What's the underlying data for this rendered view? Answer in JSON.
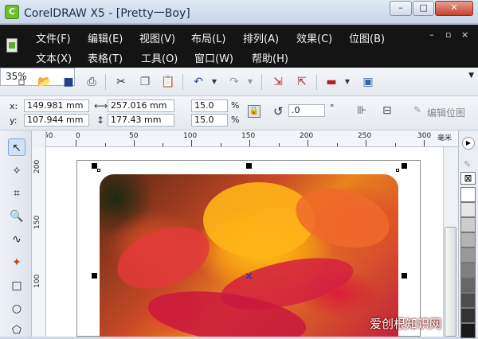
{
  "window": {
    "title": "CorelDRAW X5 - [Pretty一Boy]",
    "app_icon": "coreldraw-app-icon",
    "minimize": "–",
    "maximize": "□",
    "close": "✕"
  },
  "menubar": {
    "row1": [
      "文件(F)",
      "编辑(E)",
      "视图(V)",
      "布局(L)",
      "排列(A)",
      "效果(C)",
      "位图(B)"
    ],
    "row2": [
      "文本(X)",
      "表格(T)",
      "工具(O)",
      "窗口(W)",
      "帮助(H)"
    ],
    "mdi": [
      "–",
      "▫",
      "×"
    ]
  },
  "toolbar": {
    "icons": [
      "new-document-icon",
      "open-icon",
      "save-icon",
      "print-icon",
      "cut-icon",
      "copy-icon",
      "paste-icon",
      "undo-icon",
      "redo-icon",
      "import-icon",
      "export-icon",
      "application-launcher-icon",
      "welcome-screen-icon"
    ],
    "zoom": "35%"
  },
  "propbar": {
    "x_label": "x:",
    "x_value": "149.981 mm",
    "y_label": "y:",
    "y_value": "107.944 mm",
    "w_value": "257.016 mm",
    "h_value": "177.43 mm",
    "scale_w": "15.0",
    "scale_h": "15.0",
    "pct1": "%",
    "pct2": "%",
    "rotation": ".0",
    "degree": "°",
    "edit_bitmap": "编辑位图"
  },
  "ruler": {
    "h_labels": [
      "50",
      "0",
      "50",
      "100",
      "150",
      "200",
      "250",
      "300"
    ],
    "h_unit": "毫米",
    "v_labels": [
      "200",
      "150",
      "100"
    ]
  },
  "toolbox": [
    "pick-tool-icon",
    "shape-tool-icon",
    "crop-tool-icon",
    "zoom-tool-icon",
    "freehand-tool-icon",
    "smart-fill-tool-icon",
    "rectangle-tool-icon",
    "ellipse-tool-icon",
    "polygon-tool-icon"
  ],
  "palette": {
    "swatches": [
      "#ffffff",
      "#e6e6e6",
      "#cccccc",
      "#b3b3b3",
      "#999999",
      "#808080",
      "#666666",
      "#4d4d4d",
      "#333333",
      "#1a1a1a"
    ]
  },
  "watermark": "爱创根知识网"
}
